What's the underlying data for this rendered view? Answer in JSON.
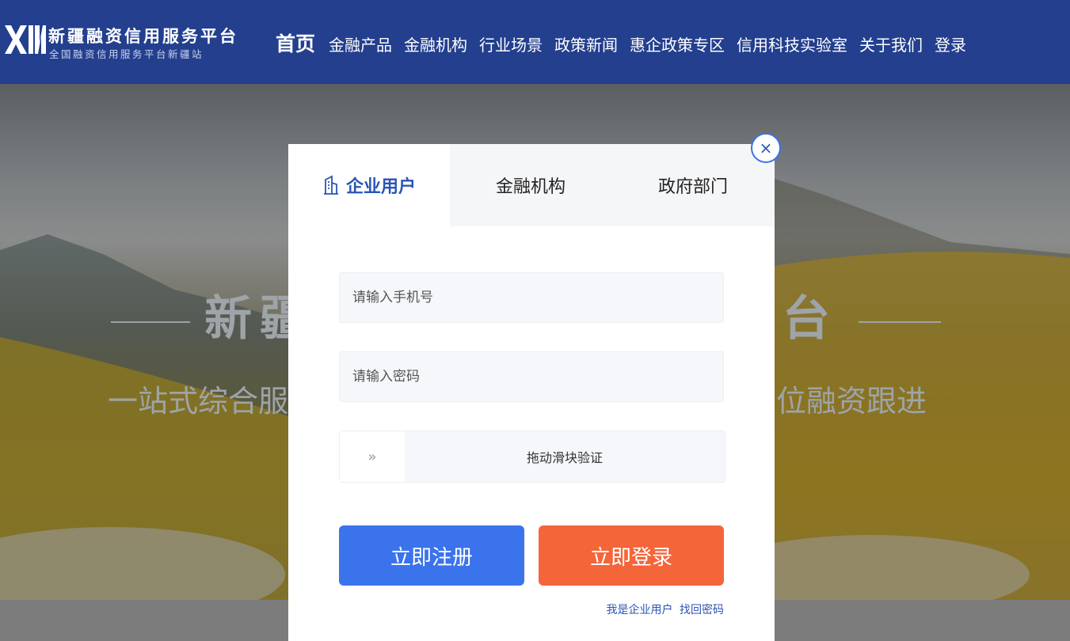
{
  "header": {
    "logo_mark": "XIN",
    "title": "新疆融资信用服务平台",
    "subtitle": "全国融资信用服务平台新疆站",
    "nav": [
      {
        "label": "首页",
        "active": true
      },
      {
        "label": "金融产品"
      },
      {
        "label": "金融机构"
      },
      {
        "label": "行业场景"
      },
      {
        "label": "政策新闻"
      },
      {
        "label": "惠企政策专区"
      },
      {
        "label": "信用科技实验室"
      },
      {
        "label": "关于我们"
      },
      {
        "label": "登录"
      }
    ]
  },
  "hero": {
    "title_left": "新",
    "title_partial": "疆",
    "title_right": "台",
    "subtitle_left": "一站式综合服",
    "subtitle_right": "位融资跟进"
  },
  "modal": {
    "close_label": "×",
    "tabs": [
      {
        "label": "企业用户",
        "active": true
      },
      {
        "label": "金融机构"
      },
      {
        "label": "政府部门"
      }
    ],
    "phone_placeholder": "请输入手机号",
    "password_placeholder": "请输入密码",
    "slider_handle": "»",
    "slider_text": "拖动滑块验证",
    "register_label": "立即注册",
    "login_label": "立即登录",
    "role_text": "我是企业用户",
    "recover_text": "找回密码"
  },
  "colors": {
    "header_bg": "#233f8e",
    "accent_blue": "#3a73ec",
    "accent_orange": "#f5653a",
    "active_tab_text": "#2a55b5"
  }
}
